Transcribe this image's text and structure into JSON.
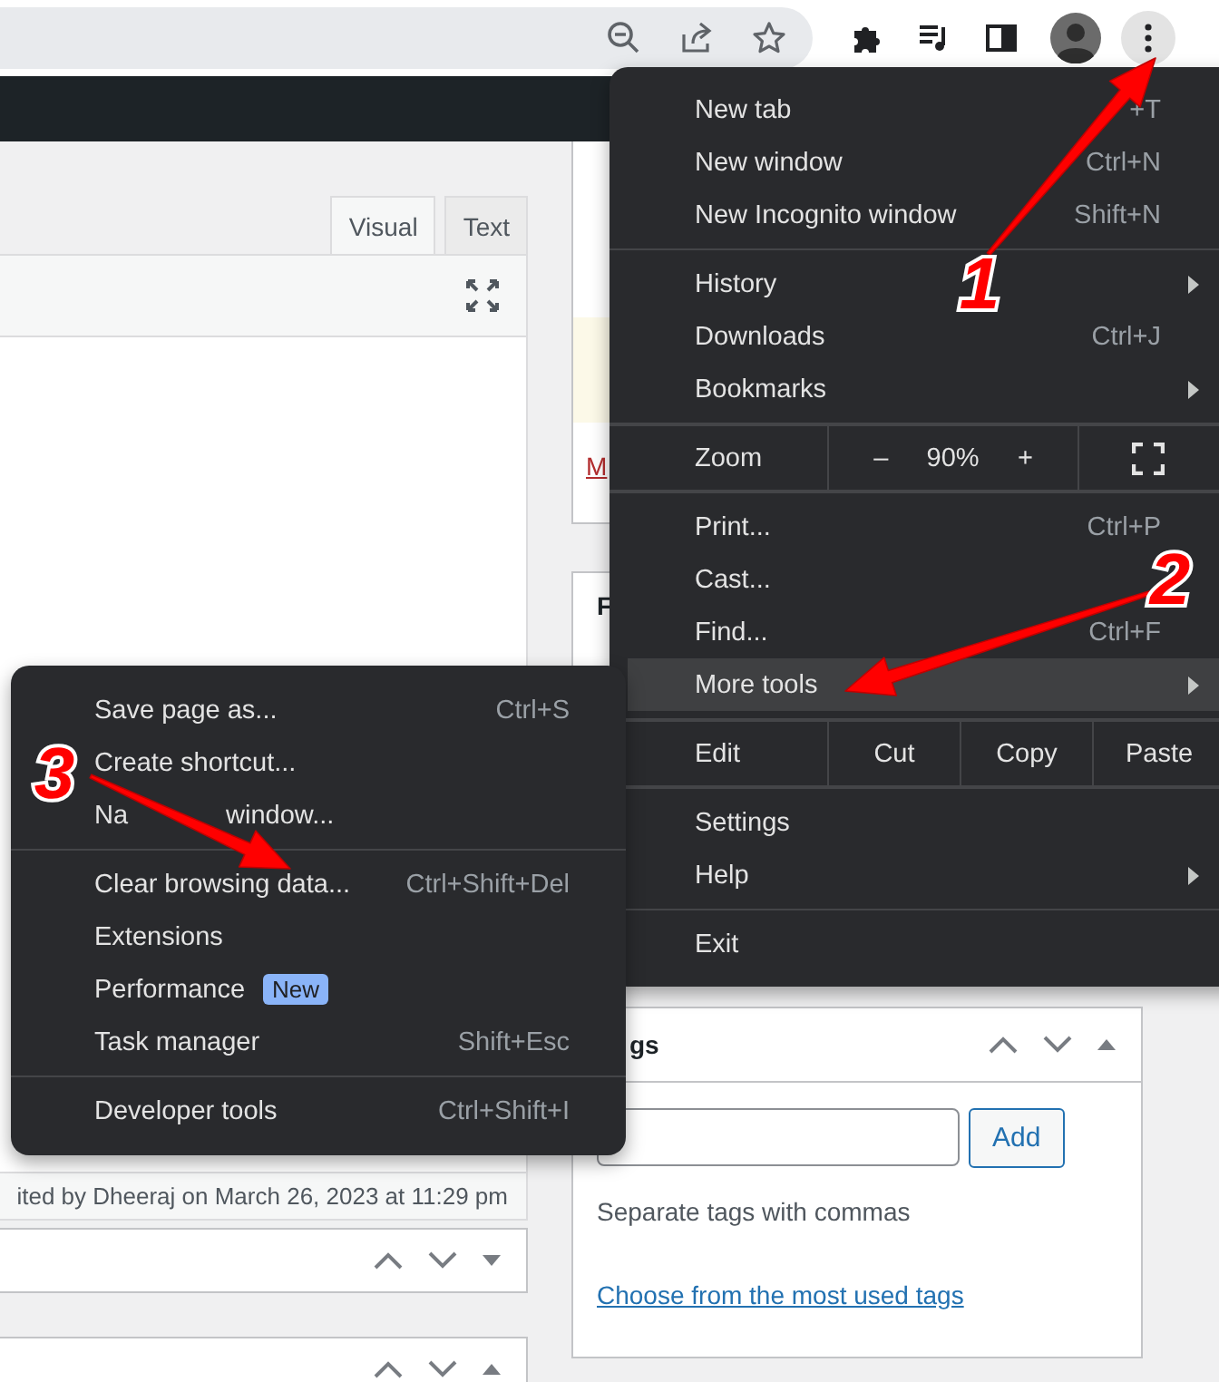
{
  "tabs": [
    {
      "label": "Visual",
      "selected": true
    },
    {
      "label": "Text",
      "selected": false
    }
  ],
  "side_box": {
    "link": "M",
    "heading": "F"
  },
  "revision_note": "ited by Dheeraj on March 26, 2023 at 11:29 pm",
  "tags_box": {
    "title": "gs",
    "add_button": "Add",
    "hint": "Separate tags with commas",
    "link": "Choose from the most used tags"
  },
  "menu": [
    {
      "kind": "item",
      "label": "New tab",
      "shortcut": "+T",
      "selected": false
    },
    {
      "kind": "item",
      "label": "New window",
      "shortcut": "Ctrl+N",
      "selected": false
    },
    {
      "kind": "item",
      "label": "New Incognito window",
      "shortcut": "Shift+N",
      "selected": false
    },
    {
      "kind": "separator"
    },
    {
      "kind": "item",
      "label": "History",
      "has_submenu": true,
      "selected": false
    },
    {
      "kind": "item",
      "label": "Downloads",
      "shortcut": "Ctrl+J",
      "selected": false
    },
    {
      "kind": "item",
      "label": "Bookmarks",
      "has_submenu": true,
      "selected": false
    },
    {
      "kind": "separator"
    },
    {
      "kind": "zoom",
      "label": "Zoom",
      "minus": "–",
      "value": "90%",
      "plus": "+"
    },
    {
      "kind": "separator"
    },
    {
      "kind": "item",
      "label": "Print...",
      "shortcut": "Ctrl+P",
      "selected": false
    },
    {
      "kind": "item",
      "label": "Cast...",
      "selected": false
    },
    {
      "kind": "item",
      "label": "Find...",
      "shortcut": "Ctrl+F",
      "selected": false
    },
    {
      "kind": "item",
      "label": "More tools",
      "has_submenu": true,
      "selected": true
    },
    {
      "kind": "separator"
    },
    {
      "kind": "edit",
      "label": "Edit",
      "actions": [
        "Cut",
        "Copy",
        "Paste"
      ]
    },
    {
      "kind": "separator"
    },
    {
      "kind": "item",
      "label": "Settings",
      "selected": false
    },
    {
      "kind": "item",
      "label": "Help",
      "has_submenu": true,
      "selected": false
    },
    {
      "kind": "separator"
    },
    {
      "kind": "item",
      "label": "Exit",
      "selected": false
    }
  ],
  "submenu": [
    {
      "kind": "item",
      "label": "Save page as...",
      "shortcut": "Ctrl+S"
    },
    {
      "kind": "item",
      "label": "Create shortcut..."
    },
    {
      "kind": "item",
      "label": "Na",
      "label_after_arrow": "window..."
    },
    {
      "kind": "separator"
    },
    {
      "kind": "item",
      "label": "Clear browsing data...",
      "shortcut": "Ctrl+Shift+Del"
    },
    {
      "kind": "item",
      "label": "Extensions"
    },
    {
      "kind": "item",
      "label": "Performance",
      "badge": "New"
    },
    {
      "kind": "item",
      "label": "Task manager",
      "shortcut": "Shift+Esc"
    },
    {
      "kind": "separator"
    },
    {
      "kind": "item",
      "label": "Developer tools",
      "shortcut": "Ctrl+Shift+I"
    }
  ],
  "annotations": [
    "1",
    "2",
    "3"
  ]
}
